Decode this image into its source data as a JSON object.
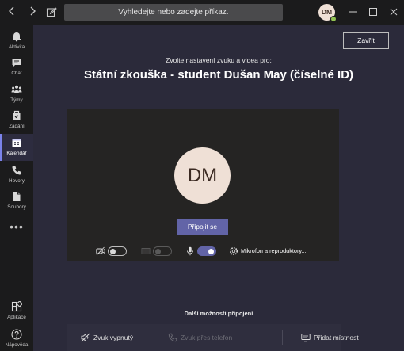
{
  "titlebar": {
    "back_icon": "chevron-left-icon",
    "forward_icon": "chevron-right-icon",
    "compose_icon": "compose-icon",
    "search_placeholder": "Vyhledejte nebo zadejte příkaz.",
    "user_initials": "DM",
    "presence_color": "#92c353"
  },
  "rail": {
    "items": [
      {
        "label": "Aktivita",
        "icon": "bell-icon"
      },
      {
        "label": "Chat",
        "icon": "chat-icon"
      },
      {
        "label": "Týmy",
        "icon": "teams-icon"
      },
      {
        "label": "Zadání",
        "icon": "assignments-icon"
      },
      {
        "label": "Kalendář",
        "icon": "calendar-icon",
        "active": true
      },
      {
        "label": "Hovory",
        "icon": "phone-icon"
      },
      {
        "label": "Soubory",
        "icon": "files-icon"
      }
    ],
    "more": "•••",
    "bottom_items": [
      {
        "label": "Aplikace",
        "icon": "apps-icon"
      },
      {
        "label": "Nápověda",
        "icon": "help-icon"
      }
    ]
  },
  "main": {
    "close_label": "Zavřít",
    "subtitle": "Zvolte nastavení zvuku a videa pro:",
    "meeting_title": "Státní zkouška - student Dušan May (číselné ID)",
    "preview": {
      "avatar_initials": "DM",
      "join_label": "Připojit se",
      "video_toggle": "off",
      "background_toggle": "disabled",
      "mic_toggle": "on",
      "devices_label": "Mikrofon a reproduktory..."
    },
    "other_options_title": "Další možnosti připojení",
    "other_options": [
      {
        "label": "Zvuk vypnutý",
        "icon": "speaker-off-icon",
        "enabled": true
      },
      {
        "label": "Zvuk přes telefon",
        "icon": "phone-icon",
        "enabled": false
      },
      {
        "label": "Přidat místnost",
        "icon": "room-icon",
        "enabled": true
      }
    ]
  },
  "colors": {
    "accent": "#6264a7",
    "main_background": "#2b2a3a",
    "preview_background": "#252423",
    "rail_background": "#1b1b1c"
  }
}
